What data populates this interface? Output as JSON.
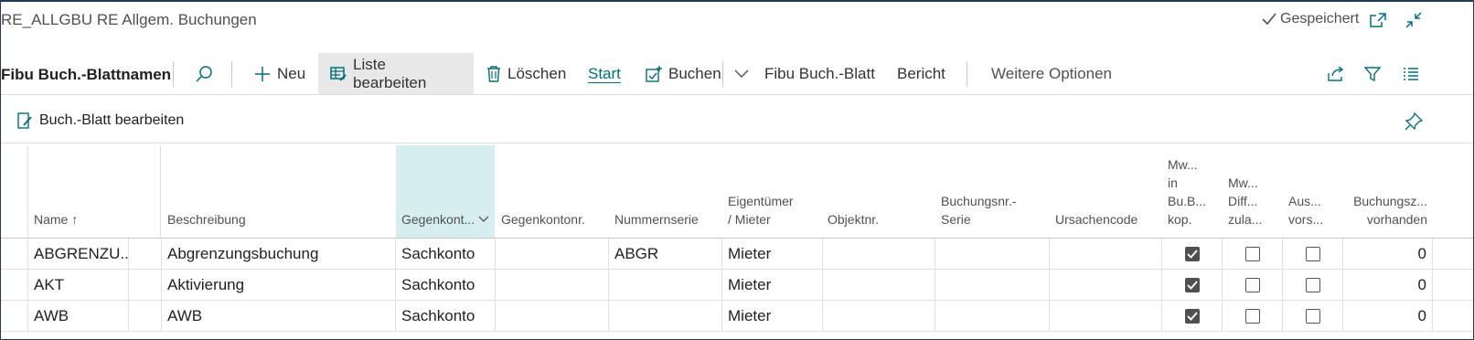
{
  "window": {
    "title": "RE_ALLGBU RE Allgem. Buchungen",
    "saved_label": "Gespeichert"
  },
  "actionbar": {
    "page_name": "Fibu Buch.-Blattnamen",
    "new_label": "Neu",
    "edit_list_label": "Liste bearbeiten",
    "delete_label": "Löschen",
    "start_label": "Start",
    "post_label": "Buchen",
    "journal_label": "Fibu Buch.-Blatt",
    "report_label": "Bericht",
    "more_label": "Weitere Optionen"
  },
  "subbar": {
    "edit_journal_label": "Buch.-Blatt bearbeiten"
  },
  "table": {
    "headers": {
      "name": "Name",
      "sort_indicator": "↑",
      "beschreibung": "Beschreibung",
      "gegenkontoart": "Gegenkont...",
      "gegenkontonr": "Gegenkontonr.",
      "nummernserie": "Nummernserie",
      "eigentuemer_1": "Eigentümer",
      "eigentuemer_2": "/ Mieter",
      "objektnr": "Objektnr.",
      "buchungsnr_1": "Buchungsnr.-",
      "buchungsnr_2": "Serie",
      "ursachencode": "Ursachencode",
      "mw_kop_1": "Mw...",
      "mw_kop_2": "in",
      "mw_kop_3": "Bu.B...",
      "mw_kop_4": "kop.",
      "mw_diff_1": "Mw...",
      "mw_diff_2": "Diff...",
      "mw_diff_3": "zula...",
      "aus_1": "Aus...",
      "aus_2": "vors...",
      "buchungsz_1": "Buchungsz...",
      "buchungsz_2": "vorhanden"
    },
    "rows": [
      {
        "name": "ABGRENZU...",
        "beschreibung": "Abgrenzungsbuchung",
        "gegenkontoart": "Sachkonto",
        "gegenkontonr": "",
        "nummernserie": "ABGR",
        "eigentuemer": "Mieter",
        "objektnr": "",
        "buchungsnr": "",
        "ursachencode": "",
        "mw_kop": true,
        "mw_diff": false,
        "aus": false,
        "buchungsz": "0"
      },
      {
        "name": "AKT",
        "beschreibung": "Aktivierung",
        "gegenkontoart": "Sachkonto",
        "gegenkontonr": "",
        "nummernserie": "",
        "eigentuemer": "Mieter",
        "objektnr": "",
        "buchungsnr": "",
        "ursachencode": "",
        "mw_kop": true,
        "mw_diff": false,
        "aus": false,
        "buchungsz": "0"
      },
      {
        "name": "AWB",
        "beschreibung": "AWB",
        "gegenkontoart": "Sachkonto",
        "gegenkontonr": "",
        "nummernserie": "",
        "eigentuemer": "Mieter",
        "objektnr": "",
        "buchungsnr": "",
        "ursachencode": "",
        "mw_kop": true,
        "mw_diff": false,
        "aus": false,
        "buchungsz": "0"
      }
    ]
  },
  "colors": {
    "accent": "#00707a",
    "highlight_column": "#d7eef0",
    "active_button": "#e8e8e8"
  }
}
